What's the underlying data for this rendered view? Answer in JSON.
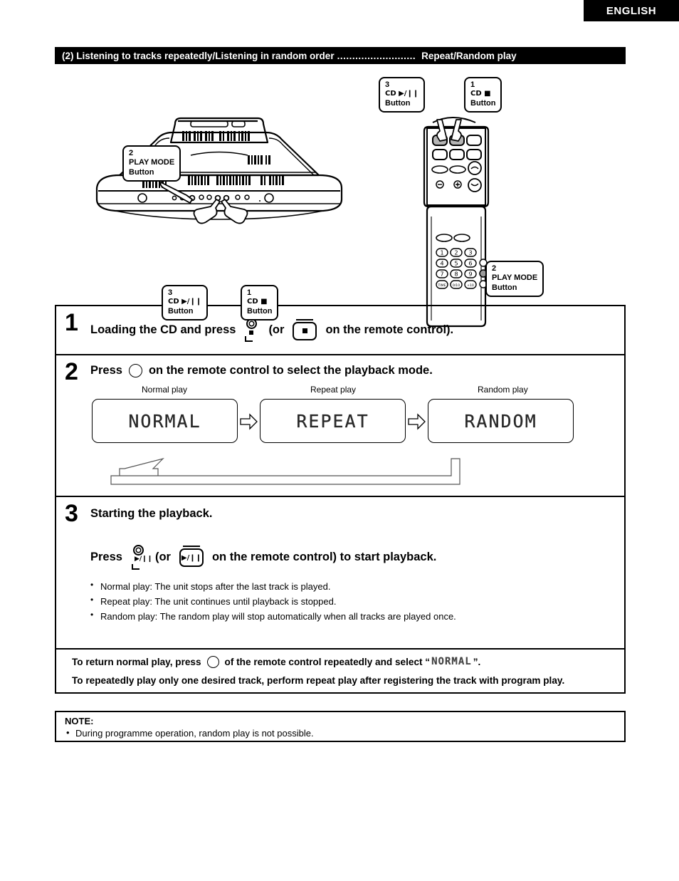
{
  "language_tab": "ENGLISH",
  "section": {
    "title": "(2) Listening to tracks repeatedly/Listening in random order",
    "dots": "..........................",
    "tail": "Repeat/Random play"
  },
  "diagram": {
    "unit_callouts": [
      {
        "num": "2",
        "line2": "PLAY MODE",
        "line3": "Button"
      },
      {
        "num": "3",
        "line2": "CD ▶/❙❙",
        "line3": "Button"
      },
      {
        "num": "1",
        "line2": "CD ■",
        "line3": "Button"
      }
    ],
    "remote_callouts": [
      {
        "num": "3",
        "line2": "CD ▶/❙❙",
        "line3": "Button"
      },
      {
        "num": "1",
        "line2": "CD ■",
        "line3": "Button"
      },
      {
        "num": "2",
        "line2": "PLAY MODE",
        "line3": "Button"
      }
    ],
    "remote_keypad": [
      "1",
      "2",
      "3",
      "4",
      "5",
      "6",
      "7",
      "8",
      "9",
      "TIME",
      "0/10",
      "+10"
    ]
  },
  "steps": [
    {
      "num": "1",
      "text_before": "Loading the CD and press",
      "text_mid": "(or",
      "text_after": "on the remote control)."
    },
    {
      "num": "2",
      "text_before": "Press",
      "text_after": "on the remote control to select the playback mode."
    },
    {
      "num": "3",
      "heading": "Starting the playback.",
      "text_before": "Press",
      "text_mid": "(or",
      "text_after": "on the remote control) to start playback.",
      "bullets": [
        "Normal play: The unit stops after the last track is played.",
        "Repeat play: The unit continues until playback is stopped.",
        "Random play: The random play will stop automatically when all tracks are played once."
      ]
    }
  ],
  "modes": [
    {
      "caption": "Normal play",
      "display": "NORMAL"
    },
    {
      "caption": "Repeat play",
      "display": "REPEAT"
    },
    {
      "caption": "Random play",
      "display": "RANDOM"
    }
  ],
  "return_box": {
    "line1_before": "To return normal play, press",
    "line1_after": "of the remote control repeatedly and select “",
    "line1_lcd": "NORMAL",
    "line1_end": "”.",
    "line2": "To repeatedly play only one desired track, perform repeat play after registering the track with program play."
  },
  "note": {
    "title": "NOTE:",
    "items": [
      "During programme operation, random play is not possible."
    ]
  },
  "glyphs": {
    "stop": "■",
    "play_pause": "▶/❙❙"
  }
}
